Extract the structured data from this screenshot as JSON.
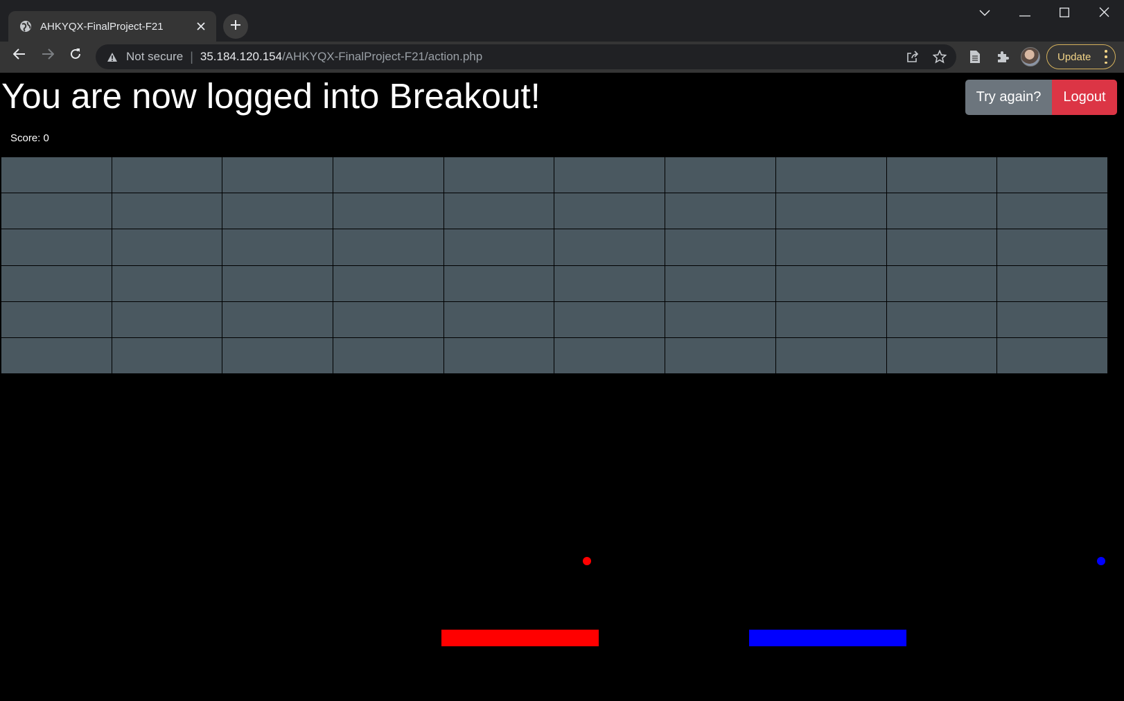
{
  "browser": {
    "tab": {
      "title": "AHKYQX-FinalProject-F21",
      "favicon": "globe-icon"
    },
    "new_tab_icon": "plus-icon",
    "window_controls": [
      "chevron-down-icon",
      "minimize-icon",
      "maximize-icon",
      "close-icon"
    ],
    "nav": {
      "back_icon": "back-arrow-icon",
      "forward_icon": "forward-arrow-icon",
      "reload_icon": "reload-icon"
    },
    "address_bar": {
      "security_icon": "warning-triangle-icon",
      "security_label": "Not secure",
      "url_host": "35.184.120.154",
      "url_path": "/AHKYQX-FinalProject-F21/action.php"
    },
    "update_label": "Update"
  },
  "page": {
    "heading": "You are now logged into Breakout!",
    "buttons": {
      "try_again": "Try again?",
      "logout": "Logout"
    },
    "score_label": "Score: 0"
  },
  "game": {
    "brick_rows": 6,
    "brick_cols": 10,
    "brick_color": "#4a5860",
    "balls": [
      {
        "player": "red",
        "color": "#ff0000"
      },
      {
        "player": "blue",
        "color": "#0000ff"
      }
    ],
    "paddles": [
      {
        "player": "red",
        "color": "#ff0000"
      },
      {
        "player": "blue",
        "color": "#0000ff"
      }
    ]
  },
  "colors": {
    "try_again_bg": "#6c757d",
    "logout_bg": "#dc3545",
    "update_accent": "#f2d487"
  }
}
